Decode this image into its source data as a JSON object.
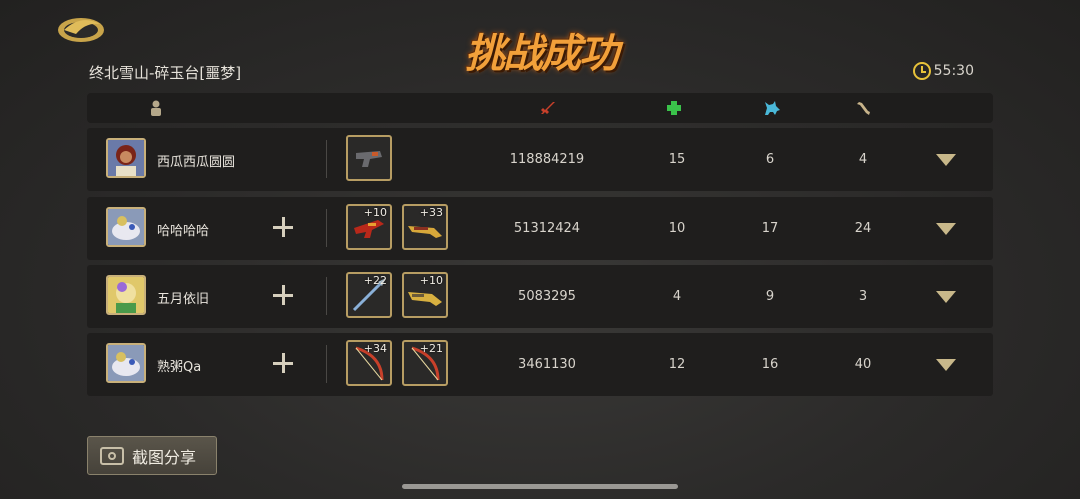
{
  "title": "挑战成功",
  "stage": "终北雪山-碎玉台[噩梦]",
  "timer": "55:30",
  "header_icons": [
    "player-icon",
    "damage-icon",
    "heal-icon",
    "wolf-icon",
    "bone-icon"
  ],
  "colors": {
    "title": "#f2a03a",
    "accent": "#e8c23a",
    "damage": "#c8402a",
    "heal": "#3ac24a",
    "wolf": "#4ab8d8"
  },
  "rows": [
    {
      "name": "西瓜西瓜圆圆",
      "has_add": false,
      "equips": [
        {
          "level": "",
          "icon": "gun-icon"
        }
      ],
      "damage": "118884219",
      "heal": "15",
      "tank": "6",
      "bone": "4"
    },
    {
      "name": "哈哈哈哈",
      "has_add": true,
      "equips": [
        {
          "level": "+10",
          "icon": "red-gun-icon"
        },
        {
          "level": "+33",
          "icon": "gold-gun-icon"
        }
      ],
      "damage": "51312424",
      "heal": "10",
      "tank": "17",
      "bone": "24"
    },
    {
      "name": "五月依旧",
      "has_add": true,
      "equips": [
        {
          "level": "+22",
          "icon": "spear-icon"
        },
        {
          "level": "+10",
          "icon": "gold-gun-icon"
        }
      ],
      "damage": "5083295",
      "heal": "4",
      "tank": "9",
      "bone": "3"
    },
    {
      "name": "熟粥Qa",
      "has_add": true,
      "equips": [
        {
          "level": "+34",
          "icon": "bow-icon"
        },
        {
          "level": "+21",
          "icon": "bow-icon"
        }
      ],
      "damage": "3461130",
      "heal": "12",
      "tank": "16",
      "bone": "40"
    }
  ],
  "share_button": "截图分享"
}
